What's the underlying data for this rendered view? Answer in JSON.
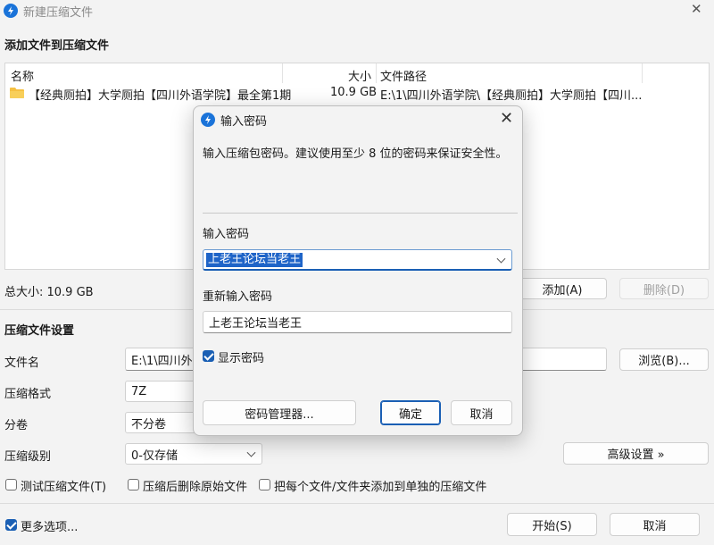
{
  "window": {
    "title": "新建压缩文件",
    "close_glyph": "✕"
  },
  "files_section": {
    "title": "添加文件到压缩文件",
    "columns": {
      "name": "名称",
      "size": "大小",
      "path": "文件路径"
    },
    "rows": [
      {
        "name": "【经典厕拍】大学厕拍【四川外语学院】最全第1期",
        "size": "10.9 GB",
        "path": "E:\\1\\四川外语学院\\【经典厕拍】大学厕拍【四川..."
      }
    ],
    "total_size": "总大小: 10.9 GB",
    "add_label": "添加(A)",
    "delete_label": "删除(D)"
  },
  "settings": {
    "title": "压缩文件设置",
    "filename_label": "文件名",
    "filename_value": "E:\\1\\四川外语",
    "browse_label": "浏览(B)...",
    "format_label": "压缩格式",
    "format_value": "7Z",
    "split_label": "分卷",
    "split_value": "不分卷",
    "level_label": "压缩级别",
    "level_value": "0-仅存储",
    "advanced_label": "高级设置 »",
    "opt_test": "测试压缩文件(T)",
    "opt_delete": "压缩后删除原始文件",
    "opt_separate": "把每个文件/文件夹添加到单独的压缩文件"
  },
  "footer": {
    "more_options": "更多选项...",
    "start_label": "开始(S)",
    "cancel_label": "取消"
  },
  "dialog": {
    "title": "输入密码",
    "close_glyph": "✕",
    "description": "输入压缩包密码。建议使用至少 8 位的密码来保证安全性。",
    "password_label": "输入密码",
    "password_value": "上老王论坛当老王",
    "reenter_label": "重新输入密码",
    "reenter_value": "上老王论坛当老王",
    "show_password_label": "显示密码",
    "show_password_checked": true,
    "manager_label": "密码管理器...",
    "ok_label": "确定",
    "cancel_label": "取消"
  },
  "colors": {
    "accent": "#1a5fb4",
    "window_bg": "#f3f3f3"
  }
}
